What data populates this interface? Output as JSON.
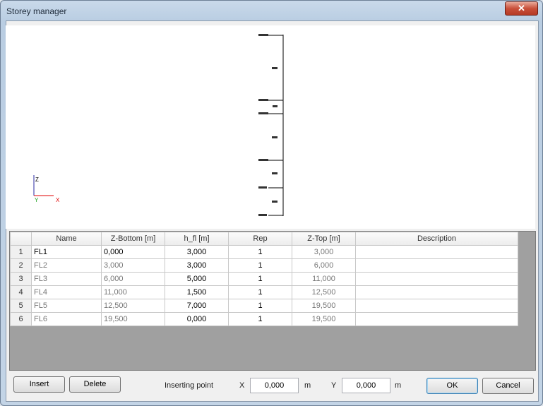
{
  "window": {
    "title": "Storey manager",
    "close_glyph": "✕"
  },
  "axis": {
    "z": "Z",
    "y": "Y",
    "x": "X",
    "y_color": "#19a019",
    "x_color": "#e00000"
  },
  "table": {
    "columns": [
      "",
      "Name",
      "Z-Bottom [m]",
      "h_fl [m]",
      "Rep",
      "Z-Top [m]",
      "Description"
    ],
    "rows": [
      {
        "num": "1",
        "name": "FL1",
        "zbottom": "0,000",
        "hfl": "3,000",
        "rep": "1",
        "ztop": "3,000",
        "desc": ""
      },
      {
        "num": "2",
        "name": "FL2",
        "zbottom": "3,000",
        "hfl": "3,000",
        "rep": "1",
        "ztop": "6,000",
        "desc": ""
      },
      {
        "num": "3",
        "name": "FL3",
        "zbottom": "6,000",
        "hfl": "5,000",
        "rep": "1",
        "ztop": "11,000",
        "desc": ""
      },
      {
        "num": "4",
        "name": "FL4",
        "zbottom": "11,000",
        "hfl": "1,500",
        "rep": "1",
        "ztop": "12,500",
        "desc": ""
      },
      {
        "num": "5",
        "name": "FL5",
        "zbottom": "12,500",
        "hfl": "7,000",
        "rep": "1",
        "ztop": "19,500",
        "desc": ""
      },
      {
        "num": "6",
        "name": "FL6",
        "zbottom": "19,500",
        "hfl": "0,000",
        "rep": "1",
        "ztop": "19,500",
        "desc": ""
      }
    ]
  },
  "buttons": {
    "insert": "Insert",
    "delete": "Delete",
    "ok": "OK",
    "cancel": "Cancel"
  },
  "inserting": {
    "label": "Inserting point",
    "x_label": "X",
    "x_value": "0,000",
    "x_unit": "m",
    "y_label": "Y",
    "y_value": "0,000",
    "y_unit": "m"
  }
}
